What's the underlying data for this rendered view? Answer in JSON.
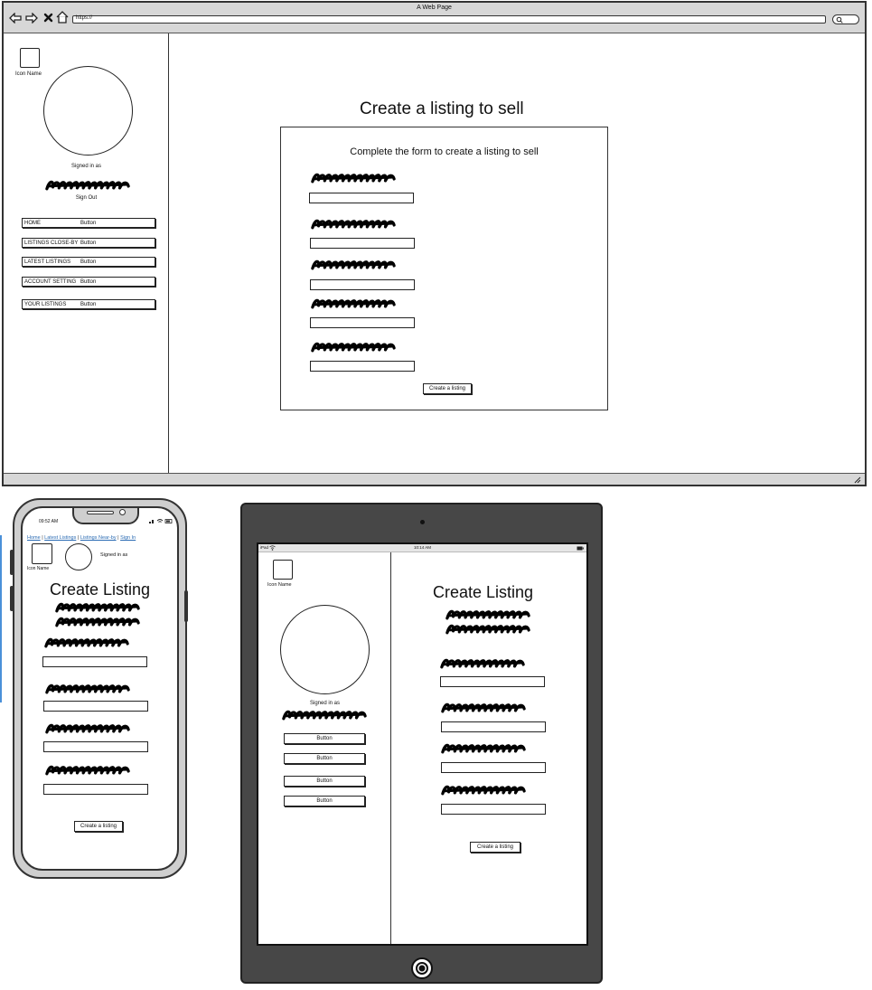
{
  "browser": {
    "title": "A Web Page",
    "url": "https://",
    "nav_icons": [
      "back-arrow-icon",
      "forward-arrow-icon",
      "close-icon",
      "home-icon"
    ]
  },
  "desktop": {
    "sidebar": {
      "icon_name": "Icon Name",
      "signed_in_as": "Signed in as",
      "sign_out": "Sign Out",
      "nav": [
        {
          "label": "HOME",
          "button": "Button"
        },
        {
          "label": "LISTINGS CLOSE-BY",
          "button": "Button"
        },
        {
          "label": "LATEST LISTINGS",
          "button": "Button"
        },
        {
          "label": "ACCOUNT SETTING",
          "button": "Button"
        },
        {
          "label": "YOUR LISTINGS",
          "button": "Button"
        }
      ]
    },
    "main": {
      "title": "Create a listing to sell",
      "form_heading": "Complete the form to create a listing to sell",
      "submit": "Create a listing"
    }
  },
  "phone": {
    "time": "09:52 AM",
    "nav_links": [
      "Home",
      "Latest Listings",
      "Listings Near-by",
      "Sign In"
    ],
    "icon_name": "Icon Name",
    "signed_in_as": "Signed in as",
    "title": "Create Listing",
    "submit": "Create a listing"
  },
  "tablet": {
    "carrier": "iPad",
    "time": "10:14 AM",
    "icon_name": "Icon Name",
    "signed_in_as": "Signed in as",
    "buttons": [
      "Button",
      "Button",
      "Button",
      "Button"
    ],
    "title": "Create Listing",
    "submit": "Create a listing"
  }
}
